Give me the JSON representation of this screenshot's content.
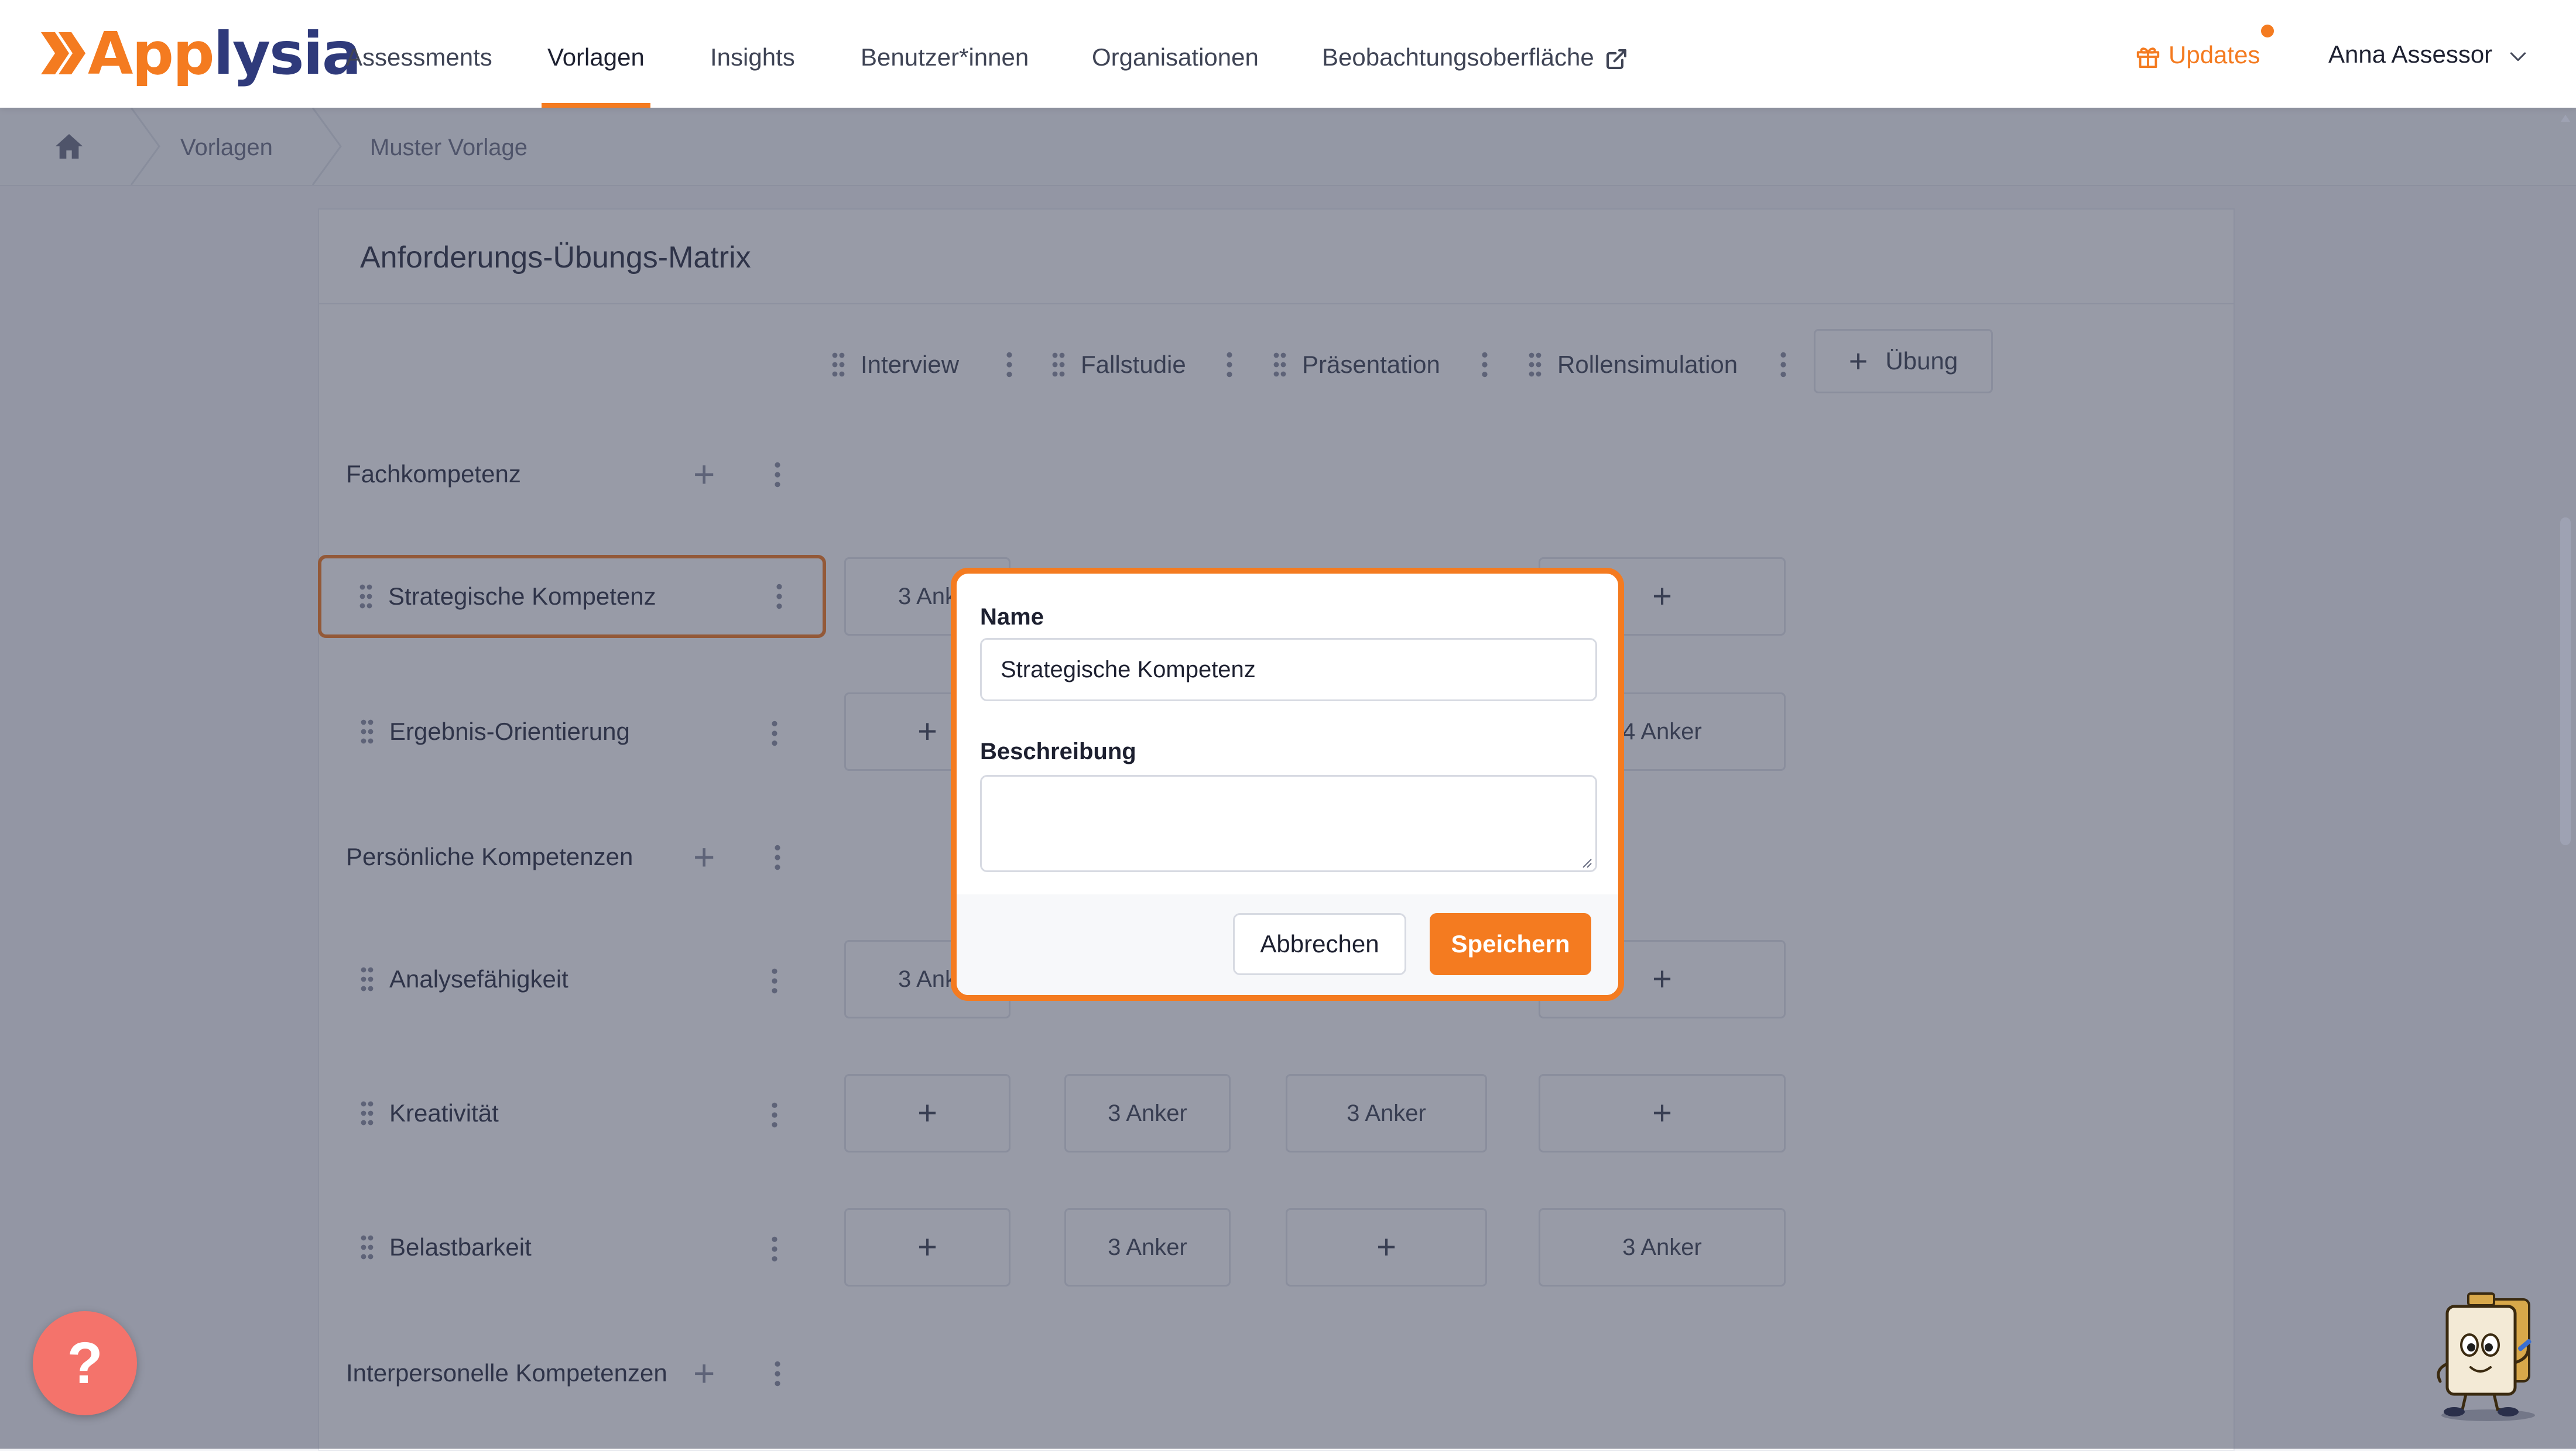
{
  "app": {
    "logo_prefix": "App",
    "logo_suffix": "lysia"
  },
  "nav": {
    "items": [
      {
        "label": "Assessments"
      },
      {
        "label": "Vorlagen",
        "active": true
      },
      {
        "label": "Insights"
      },
      {
        "label": "Benutzer*innen"
      },
      {
        "label": "Organisationen"
      },
      {
        "label": "Beobachtungsoberfläche",
        "icon": "external-link-icon"
      }
    ],
    "updates_label": "Updates",
    "user_name": "Anna Assessor"
  },
  "breadcrumb": {
    "items": [
      "Vorlagen",
      "Muster Vorlage"
    ]
  },
  "matrix": {
    "title": "Anforderungs-Übungs-Matrix",
    "exercises": [
      "Interview",
      "Fallstudie",
      "Präsentation",
      "Rollensimulation"
    ],
    "add_exercise_label": "Übung",
    "groups": [
      {
        "name": "Fachkompetenz"
      },
      {
        "name": "Persönliche Kompetenzen"
      },
      {
        "name": "Interpersonelle Kompetenzen"
      }
    ],
    "rows": [
      {
        "name": "Strategische Kompetenz",
        "cells": [
          "3 Ank",
          "",
          "",
          "+"
        ]
      },
      {
        "name": "Ergebnis-Orientierung",
        "cells": [
          "+",
          "",
          "",
          "4 Anker"
        ]
      },
      {
        "name": "Analysefähigkeit",
        "cells": [
          "3 Ank",
          "",
          "",
          "+"
        ]
      },
      {
        "name": "Kreativität",
        "cells": [
          "+",
          "3 Anker",
          "3 Anker",
          "+"
        ]
      },
      {
        "name": "Belastbarkeit",
        "cells": [
          "+",
          "3 Anker",
          "+",
          "3 Anker"
        ]
      }
    ]
  },
  "modal": {
    "name_label": "Name",
    "name_value": "Strategische Kompetenz",
    "description_label": "Beschreibung",
    "description_value": "",
    "cancel_label": "Abbrechen",
    "save_label": "Speichern"
  },
  "help": {
    "label": "?"
  },
  "colors": {
    "accent": "#f47b20",
    "brand_dark": "#2f3a7b",
    "help_button": "#f4736b"
  }
}
